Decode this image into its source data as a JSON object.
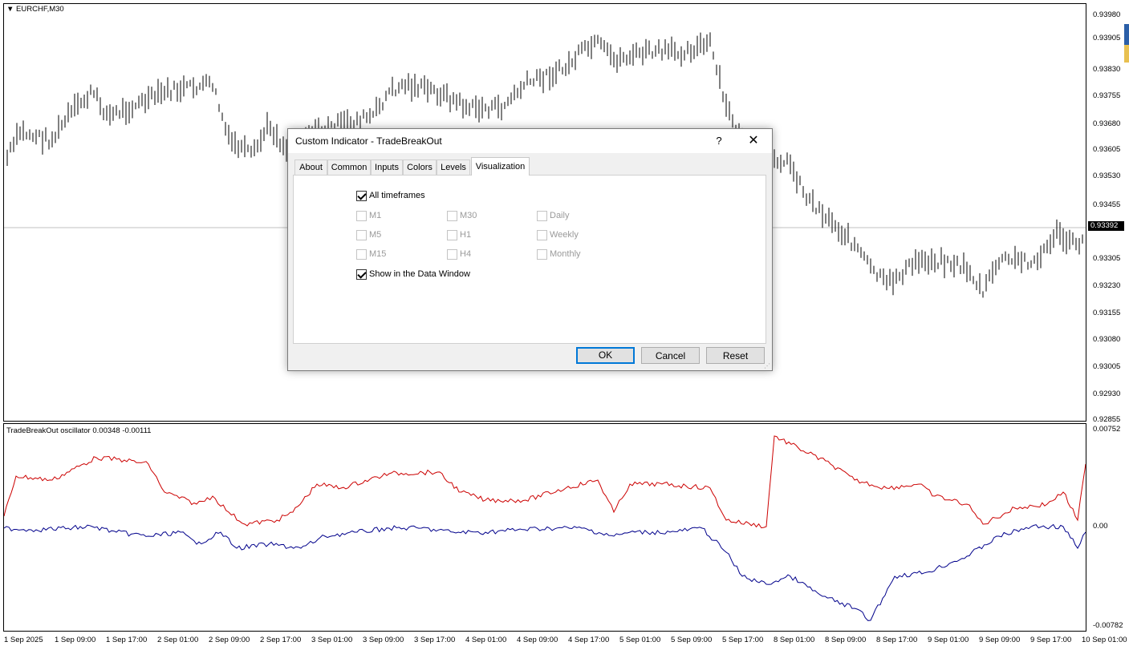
{
  "chart": {
    "symbol_label": "EURCHF,M30",
    "current_price": "0.93392",
    "price_axis": [
      "0.93980",
      "0.93905",
      "0.93830",
      "0.93755",
      "0.93680",
      "0.93605",
      "0.93530",
      "0.93455",
      "0.93305",
      "0.93230",
      "0.93155",
      "0.93080",
      "0.93005",
      "0.92930",
      "0.92855"
    ],
    "time_axis": [
      "1 Sep 2025",
      "1 Sep 09:00",
      "1 Sep 17:00",
      "2 Sep 01:00",
      "2 Sep 09:00",
      "2 Sep 17:00",
      "3 Sep 01:00",
      "3 Sep 09:00",
      "3 Sep 17:00",
      "4 Sep 01:00",
      "4 Sep 09:00",
      "4 Sep 17:00",
      "5 Sep 01:00",
      "5 Sep 09:00",
      "5 Sep 17:00",
      "8 Sep 01:00",
      "8 Sep 09:00",
      "8 Sep 17:00",
      "9 Sep 01:00",
      "9 Sep 09:00",
      "9 Sep 17:00",
      "10 Sep 01:00"
    ]
  },
  "oscillator": {
    "title": "TradeBreakOut oscillator 0.00348 -0.00111",
    "axis": [
      "0.00752",
      "0.00",
      "-0.00782"
    ],
    "colors": {
      "line1": "#cc0000",
      "line2": "#00008b"
    }
  },
  "dialog": {
    "title": "Custom Indicator - TradeBreakOut",
    "help": "?",
    "close": "✕",
    "tabs": [
      "About",
      "Common",
      "Inputs",
      "Colors",
      "Levels",
      "Visualization"
    ],
    "active_tab": "Visualization",
    "all_timeframes": "All timeframes",
    "timeframes": [
      "M1",
      "M30",
      "Daily",
      "M5",
      "H1",
      "Weekly",
      "M15",
      "H4",
      "Monthly"
    ],
    "show_data_window": "Show in the Data Window",
    "buttons": {
      "ok": "OK",
      "cancel": "Cancel",
      "reset": "Reset"
    }
  }
}
